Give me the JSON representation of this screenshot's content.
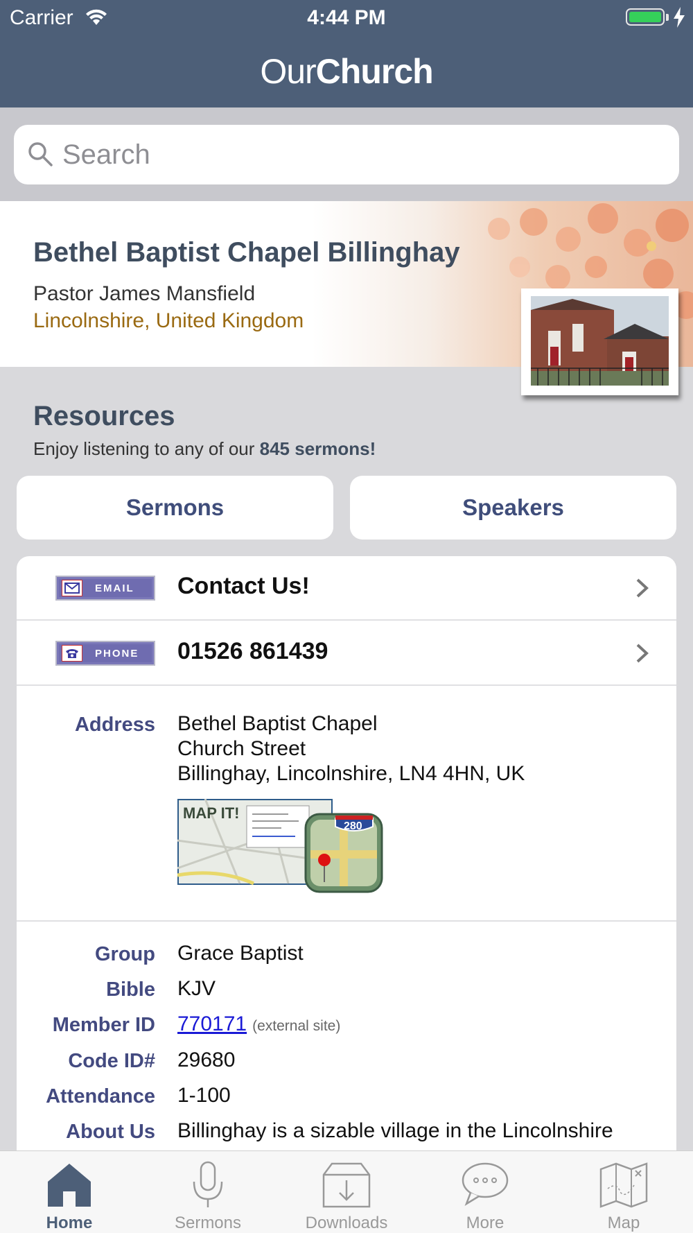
{
  "status": {
    "carrier": "Carrier",
    "time": "4:44 PM"
  },
  "header": {
    "logo_part1": "Our",
    "logo_part2": "Church"
  },
  "search": {
    "placeholder": "Search"
  },
  "church": {
    "name": "Bethel Baptist Chapel Billinghay",
    "pastor": "Pastor James Mansfield",
    "location": "Lincolnshire, United Kingdom"
  },
  "resources": {
    "title": "Resources",
    "subtitle_prefix": "Enjoy listening to any of our ",
    "subtitle_bold": "845 sermons!",
    "sermons_button": "Sermons",
    "speakers_button": "Speakers"
  },
  "contact": {
    "email_tag": "EMAIL",
    "email_label": "Contact Us!",
    "phone_tag": "PHONE",
    "phone_number": "01526 861439"
  },
  "address": {
    "label": "Address",
    "line1": "Bethel Baptist Chapel",
    "line2": "Church Street",
    "line3": "Billinghay, Lincolnshire, LN4 4HN, UK",
    "map_text": "MAP IT!",
    "map_badge": "280"
  },
  "details": {
    "group_label": "Group",
    "group_value": "Grace Baptist",
    "bible_label": "Bible",
    "bible_value": "KJV",
    "member_label": "Member ID",
    "member_value": "770171",
    "member_note": "(external site)",
    "code_label": "Code ID#",
    "code_value": "29680",
    "attendance_label": "Attendance",
    "attendance_value": "1-100",
    "about_label": "About Us",
    "about_value": "Billinghay is a sizable village in the Lincolnshire"
  },
  "tabs": [
    {
      "label": "Home",
      "icon": "home-icon",
      "active": true
    },
    {
      "label": "Sermons",
      "icon": "microphone-icon",
      "active": false
    },
    {
      "label": "Downloads",
      "icon": "download-icon",
      "active": false
    },
    {
      "label": "More",
      "icon": "chat-bubble-icon",
      "active": false
    },
    {
      "label": "Map",
      "icon": "map-icon",
      "active": false
    }
  ],
  "colors": {
    "header": "#4d5f78",
    "accent_text": "#3f4d7a",
    "label": "#434a80",
    "location": "#9a6a12",
    "link": "#1a1ad6"
  }
}
